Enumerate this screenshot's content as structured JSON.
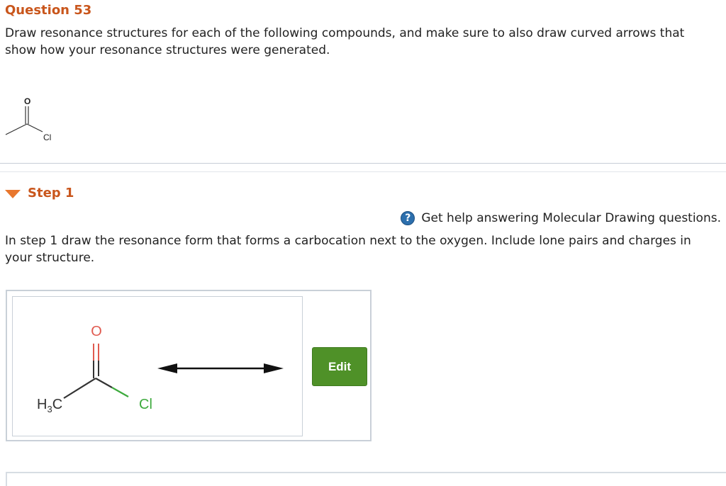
{
  "question": {
    "title": "Question 53",
    "text": "Draw resonance structures for each of the following compounds, and make sure to also draw curved arrows that show how your resonance structures were generated.",
    "molecule_labels": {
      "oxygen": "O",
      "chlorine": "Cl"
    }
  },
  "step": {
    "title": "Step 1",
    "help_text": "Get help answering Molecular Drawing questions.",
    "help_icon": "help-question-icon",
    "instruction": "In step 1 draw the resonance form that forms a carbocation next to the oxygen. Include lone pairs and charges in your structure."
  },
  "drawing": {
    "oxygen_label": "O",
    "methyl_label": "H",
    "methyl_subscript": "3",
    "methyl_carbon": "C",
    "chlorine_label": "Cl",
    "edit_label": "Edit"
  },
  "colors": {
    "title": "#c9561c",
    "caret": "#e8772e",
    "help_icon": "#2c6fad",
    "edit_button": "#4f9128",
    "oxygen": "#e05a4f",
    "chlorine": "#3daa3d"
  }
}
